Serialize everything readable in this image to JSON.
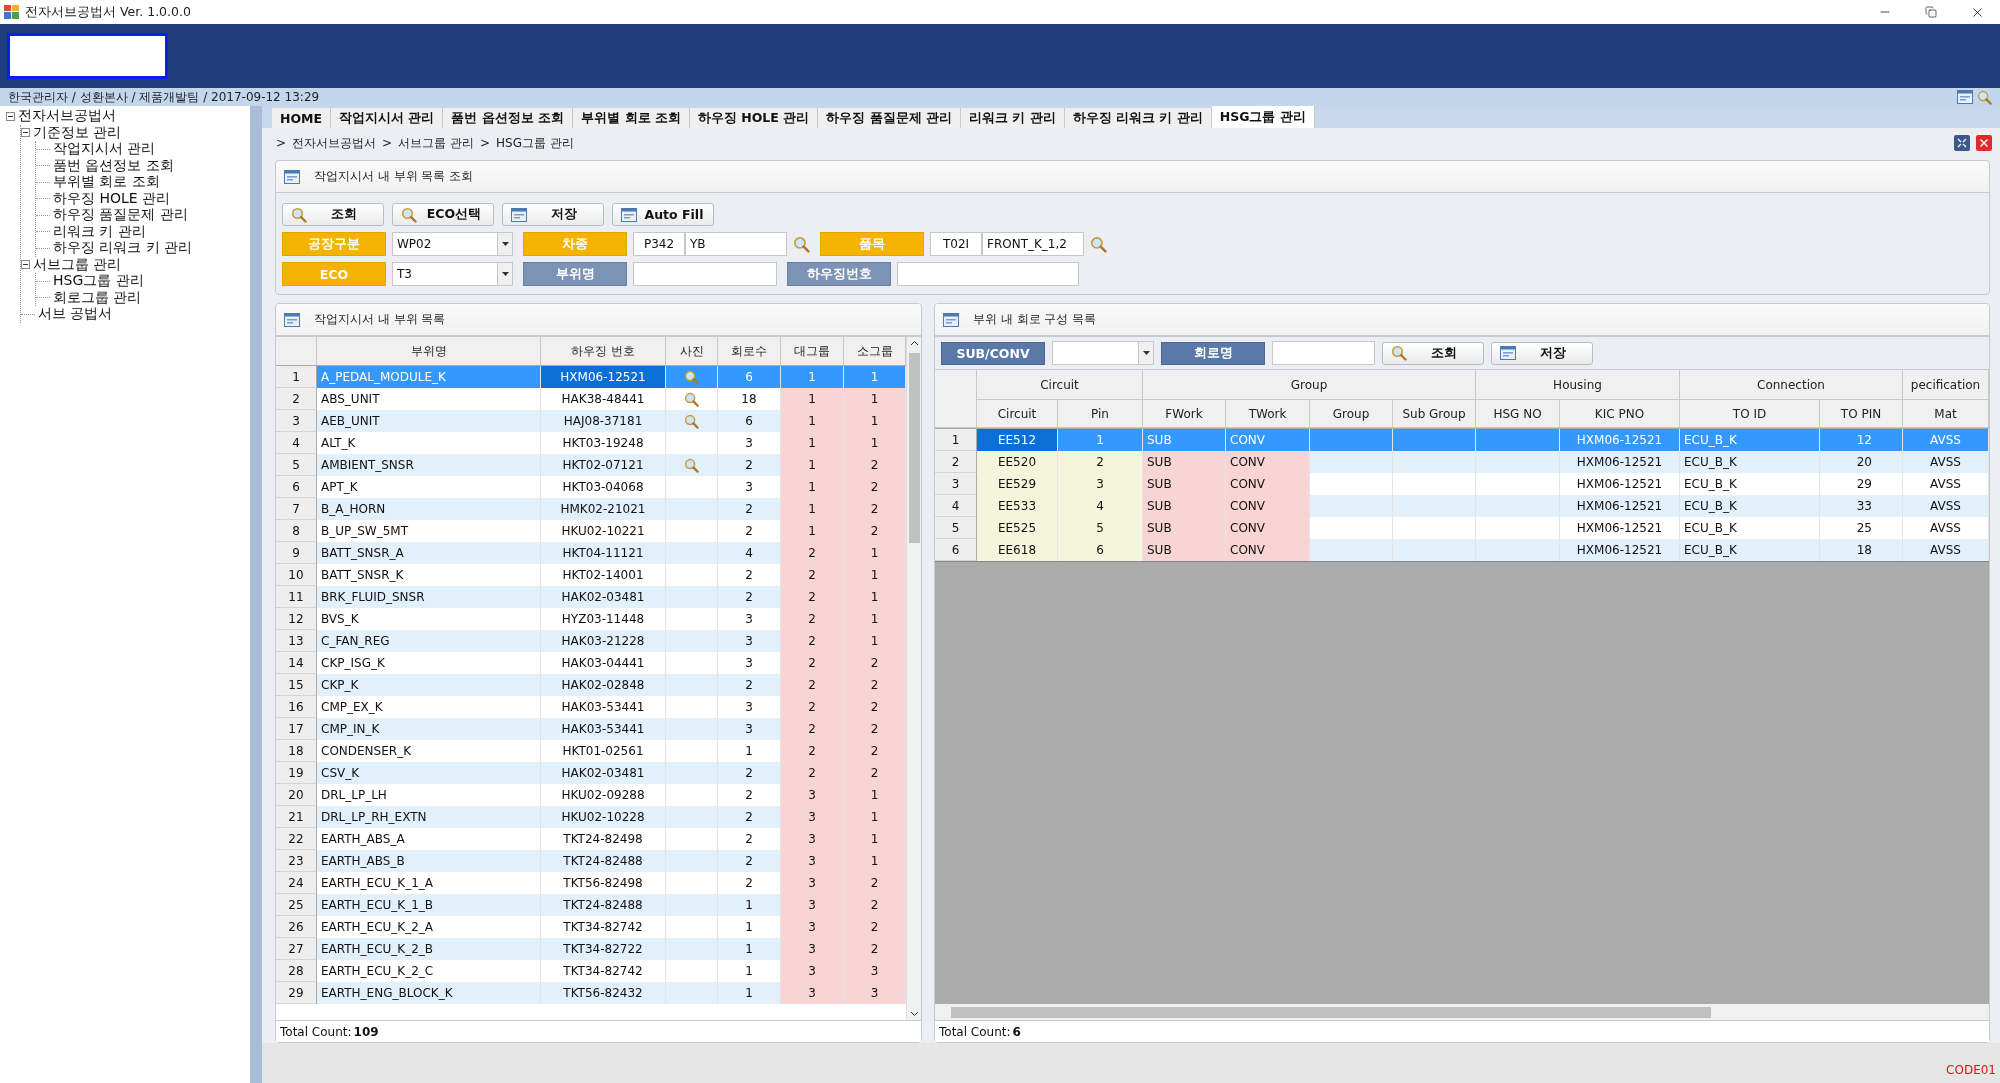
{
  "window": {
    "title": "전자서브공법서 Ver. 1.0.0.0"
  },
  "user_info": "한국관리자 / 성환본사 / 제품개발팀 / 2017-09-12 13:29",
  "tree": [
    {
      "label": "전자서브공법서",
      "expanded": true,
      "children": [
        {
          "label": "기준정보 관리",
          "expanded": true,
          "children": [
            {
              "label": "작업지시서 관리"
            },
            {
              "label": "품번 옵션정보 조회"
            },
            {
              "label": "부위별 회로 조회"
            },
            {
              "label": "하우징 HOLE 관리"
            },
            {
              "label": "하우징 품질문제 관리"
            },
            {
              "label": "리워크 키 관리"
            },
            {
              "label": "하우징 리워크 키 관리"
            }
          ]
        },
        {
          "label": "서브그룹 관리",
          "expanded": true,
          "children": [
            {
              "label": "HSG그룹 관리"
            },
            {
              "label": "회로그룹 관리"
            }
          ]
        },
        {
          "label": "서브 공법서"
        }
      ]
    }
  ],
  "tabs": [
    {
      "label": "HOME",
      "selected": false
    },
    {
      "label": "작업지시서 관리",
      "selected": false
    },
    {
      "label": "품번 옵션정보 조회",
      "selected": false
    },
    {
      "label": "부위별 회로 조회",
      "selected": false
    },
    {
      "label": "하우징 HOLE 관리",
      "selected": false
    },
    {
      "label": "하우징 품질문제 관리",
      "selected": false
    },
    {
      "label": "리워크 키 관리",
      "selected": false
    },
    {
      "label": "하우징 리워크 키 관리",
      "selected": false
    },
    {
      "label": "HSG그룹 관리",
      "selected": true
    }
  ],
  "breadcrumb": [
    {
      "separator": ">",
      "label": "전자서브공법서"
    },
    {
      "separator": ">",
      "label": "서브그룹 관리"
    },
    {
      "separator": ">",
      "label": "HSG그룹 관리"
    }
  ],
  "search_panel": {
    "title": "작업지시서 내 부위 목록 조회",
    "buttons": [
      {
        "label": "조회",
        "kind": "search"
      },
      {
        "label": "ECO선택",
        "kind": "search"
      },
      {
        "label": "저장",
        "kind": "save"
      },
      {
        "label": "Auto Fill",
        "kind": "save"
      }
    ],
    "field_rows": [
      [
        {
          "label": "공장구분",
          "required": true,
          "kind": "select",
          "value": "WP02"
        },
        {
          "label": "차종",
          "required": true,
          "kind": "code",
          "code": "P342",
          "value": "YB"
        },
        {
          "label": "품목",
          "required": true,
          "kind": "code",
          "code": "T02I",
          "value": "FRONT_K_1,2"
        }
      ],
      [
        {
          "label": "ECO",
          "required": true,
          "kind": "select",
          "value": "T3"
        },
        {
          "label": "부위명",
          "required": false,
          "kind": "text"
        },
        {
          "label": "하우징번호",
          "required": false,
          "kind": "text"
        }
      ]
    ]
  },
  "part_grid": {
    "title": "작업지시서 내 부위 목록",
    "columns": [
      "부위명",
      "하우징 번호",
      "사진",
      "회로수",
      "대그룹",
      "소그룹"
    ],
    "rows": [
      {
        "no": "1",
        "name": "A_PEDAL_MODULE_K",
        "housing": "HXM06-12521",
        "photo": true,
        "circuits": "6",
        "major": "1",
        "minor": "1",
        "selected": true
      },
      {
        "no": "2",
        "name": "ABS_UNIT",
        "housing": "HAK38-48441",
        "photo": true,
        "circuits": "18",
        "major": "1",
        "minor": "1",
        "selected": false
      },
      {
        "no": "3",
        "name": "AEB_UNIT",
        "housing": "HAJ08-37181",
        "photo": true,
        "circuits": "6",
        "major": "1",
        "minor": "1",
        "selected": false
      },
      {
        "no": "4",
        "name": "ALT_K",
        "housing": "HKT03-19248",
        "photo": false,
        "circuits": "3",
        "major": "1",
        "minor": "1",
        "selected": false
      },
      {
        "no": "5",
        "name": "AMBIENT_SNSR",
        "housing": "HKT02-07121",
        "photo": true,
        "circuits": "2",
        "major": "1",
        "minor": "2",
        "selected": false
      },
      {
        "no": "6",
        "name": "APT_K",
        "housing": "HKT03-04068",
        "photo": false,
        "circuits": "3",
        "major": "1",
        "minor": "2",
        "selected": false
      },
      {
        "no": "7",
        "name": "B_A_HORN",
        "housing": "HMK02-21021",
        "photo": false,
        "circuits": "2",
        "major": "1",
        "minor": "2",
        "selected": false
      },
      {
        "no": "8",
        "name": "B_UP_SW_5MT",
        "housing": "HKU02-10221",
        "photo": false,
        "circuits": "2",
        "major": "1",
        "minor": "2",
        "selected": false
      },
      {
        "no": "9",
        "name": "BATT_SNSR_A",
        "housing": "HKT04-11121",
        "photo": false,
        "circuits": "4",
        "major": "2",
        "minor": "1",
        "selected": false
      },
      {
        "no": "10",
        "name": "BATT_SNSR_K",
        "housing": "HKT02-14001",
        "photo": false,
        "circuits": "2",
        "major": "2",
        "minor": "1",
        "selected": false
      },
      {
        "no": "11",
        "name": "BRK_FLUID_SNSR",
        "housing": "HAK02-03481",
        "photo": false,
        "circuits": "2",
        "major": "2",
        "minor": "1",
        "selected": false
      },
      {
        "no": "12",
        "name": "BVS_K",
        "housing": "HYZ03-11448",
        "photo": false,
        "circuits": "3",
        "major": "2",
        "minor": "1",
        "selected": false
      },
      {
        "no": "13",
        "name": "C_FAN_REG",
        "housing": "HAK03-21228",
        "photo": false,
        "circuits": "3",
        "major": "2",
        "minor": "1",
        "selected": false
      },
      {
        "no": "14",
        "name": "CKP_ISG_K",
        "housing": "HAK03-04441",
        "photo": false,
        "circuits": "3",
        "major": "2",
        "minor": "2",
        "selected": false
      },
      {
        "no": "15",
        "name": "CKP_K",
        "housing": "HAK02-02848",
        "photo": false,
        "circuits": "2",
        "major": "2",
        "minor": "2",
        "selected": false
      },
      {
        "no": "16",
        "name": "CMP_EX_K",
        "housing": "HAK03-53441",
        "photo": false,
        "circuits": "3",
        "major": "2",
        "minor": "2",
        "selected": false
      },
      {
        "no": "17",
        "name": "CMP_IN_K",
        "housing": "HAK03-53441",
        "photo": false,
        "circuits": "3",
        "major": "2",
        "minor": "2",
        "selected": false
      },
      {
        "no": "18",
        "name": "CONDENSER_K",
        "housing": "HKT01-02561",
        "photo": false,
        "circuits": "1",
        "major": "2",
        "minor": "2",
        "selected": false
      },
      {
        "no": "19",
        "name": "CSV_K",
        "housing": "HAK02-03481",
        "photo": false,
        "circuits": "2",
        "major": "2",
        "minor": "2",
        "selected": false
      },
      {
        "no": "20",
        "name": "DRL_LP_LH",
        "housing": "HKU02-09288",
        "photo": false,
        "circuits": "2",
        "major": "3",
        "minor": "1",
        "selected": false
      },
      {
        "no": "21",
        "name": "DRL_LP_RH_EXTN",
        "housing": "HKU02-10228",
        "photo": false,
        "circuits": "2",
        "major": "3",
        "minor": "1",
        "selected": false
      },
      {
        "no": "22",
        "name": "EARTH_ABS_A",
        "housing": "TKT24-82498",
        "photo": false,
        "circuits": "2",
        "major": "3",
        "minor": "1",
        "selected": false
      },
      {
        "no": "23",
        "name": "EARTH_ABS_B",
        "housing": "TKT24-82488",
        "photo": false,
        "circuits": "2",
        "major": "3",
        "minor": "1",
        "selected": false
      },
      {
        "no": "24",
        "name": "EARTH_ECU_K_1_A",
        "housing": "TKT56-82498",
        "photo": false,
        "circuits": "2",
        "major": "3",
        "minor": "2",
        "selected": false
      },
      {
        "no": "25",
        "name": "EARTH_ECU_K_1_B",
        "housing": "TKT24-82488",
        "photo": false,
        "circuits": "1",
        "major": "3",
        "minor": "2",
        "selected": false
      },
      {
        "no": "26",
        "name": "EARTH_ECU_K_2_A",
        "housing": "TKT34-82742",
        "photo": false,
        "circuits": "1",
        "major": "3",
        "minor": "2",
        "selected": false
      },
      {
        "no": "27",
        "name": "EARTH_ECU_K_2_B",
        "housing": "TKT34-82722",
        "photo": false,
        "circuits": "1",
        "major": "3",
        "minor": "2",
        "selected": false
      },
      {
        "no": "28",
        "name": "EARTH_ECU_K_2_C",
        "housing": "TKT34-82742",
        "photo": false,
        "circuits": "1",
        "major": "3",
        "minor": "3",
        "selected": false
      },
      {
        "no": "29",
        "name": "EARTH_ENG_BLOCK_K",
        "housing": "TKT56-82432",
        "photo": false,
        "circuits": "1",
        "major": "3",
        "minor": "3",
        "selected": false
      }
    ],
    "total": {
      "label": "Total Count:",
      "value": "109"
    }
  },
  "circuit_grid": {
    "title": "부위 내 회로 구성 목록",
    "toolbar": {
      "type_label": "SUB/CONV",
      "name_label": "회로명",
      "buttons": [
        {
          "label": "조회",
          "kind": "search"
        },
        {
          "label": "저장",
          "kind": "save"
        }
      ]
    },
    "column_groups": [
      {
        "label": "Circuit",
        "columns": [
          "Circuit",
          "Pin"
        ]
      },
      {
        "label": "Group",
        "columns": [
          "FWork",
          "TWork",
          "Group",
          "Sub Group"
        ]
      },
      {
        "label": "Housing",
        "columns": [
          "HSG NO",
          "KIC PNO"
        ]
      },
      {
        "label": "Connection",
        "columns": [
          "TO ID",
          "TO PIN"
        ]
      },
      {
        "label": "pecification",
        "columns": [
          "Mat"
        ]
      }
    ],
    "rows": [
      {
        "no": "1",
        "circuit": "EE512",
        "pin": "1",
        "fwork": "SUB",
        "twork": "CONV",
        "kic_pno": "HXM06-12521",
        "to_id": "ECU_B_K",
        "to_pin": "12",
        "mat": "AVSS",
        "selected": true
      },
      {
        "no": "2",
        "circuit": "EE520",
        "pin": "2",
        "fwork": "SUB",
        "twork": "CONV",
        "kic_pno": "HXM06-12521",
        "to_id": "ECU_B_K",
        "to_pin": "20",
        "mat": "AVSS",
        "selected": false
      },
      {
        "no": "3",
        "circuit": "EE529",
        "pin": "3",
        "fwork": "SUB",
        "twork": "CONV",
        "kic_pno": "HXM06-12521",
        "to_id": "ECU_B_K",
        "to_pin": "29",
        "mat": "AVSS",
        "selected": false
      },
      {
        "no": "4",
        "circuit": "EE533",
        "pin": "4",
        "fwork": "SUB",
        "twork": "CONV",
        "kic_pno": "HXM06-12521",
        "to_id": "ECU_B_K",
        "to_pin": "33",
        "mat": "AVSS",
        "selected": false
      },
      {
        "no": "5",
        "circuit": "EE525",
        "pin": "5",
        "fwork": "SUB",
        "twork": "CONV",
        "kic_pno": "HXM06-12521",
        "to_id": "ECU_B_K",
        "to_pin": "25",
        "mat": "AVSS",
        "selected": false
      },
      {
        "no": "6",
        "circuit": "EE618",
        "pin": "6",
        "fwork": "SUB",
        "twork": "CONV",
        "kic_pno": "HXM06-12521",
        "to_id": "ECU_B_K",
        "to_pin": "18",
        "mat": "AVSS",
        "selected": false
      }
    ],
    "total": {
      "label": "Total Count:",
      "value": "6"
    }
  },
  "footer_code": "CODE01"
}
